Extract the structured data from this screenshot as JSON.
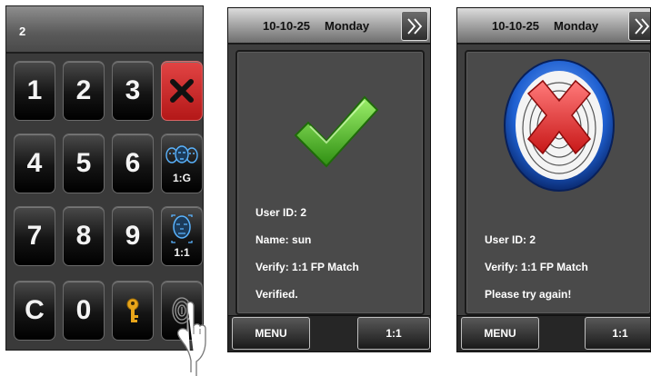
{
  "keypad": {
    "display_value": "2",
    "keys": {
      "k1": "1",
      "k2": "2",
      "k3": "3",
      "k4": "4",
      "k5": "5",
      "k6": "6",
      "k7": "7",
      "k8": "8",
      "k9": "9",
      "clear": "C",
      "k0": "0"
    },
    "group_verify_label": "1:G",
    "single_verify_label": "1:1",
    "icons": [
      "delete-x-icon",
      "group-faces-icon",
      "face-icon",
      "key-icon",
      "fingerprint-icon",
      "pointing-hand-icon"
    ]
  },
  "success_screen": {
    "date": "10-10-25",
    "day": "Monday",
    "lines": {
      "user_id": "User ID: 2",
      "name": "Name: sun",
      "verify": "Verify: 1:1 FP Match",
      "result": "Verified."
    },
    "menu_label": "MENU",
    "mode_label": "1:1",
    "icons": [
      "double-chevron-right-icon",
      "green-check-icon"
    ]
  },
  "failure_screen": {
    "date": "10-10-25",
    "day": "Monday",
    "lines": {
      "user_id": "User ID: 2",
      "verify": "Verify: 1:1 FP Match",
      "result": "Please try again!"
    },
    "menu_label": "MENU",
    "mode_label": "1:1",
    "icons": [
      "double-chevron-right-icon",
      "fingerprint-fail-icon"
    ]
  },
  "colors": {
    "delete_key": "#c62222",
    "check_green": "#3fae1c",
    "fail_red": "#e23a3a",
    "fail_ring_blue": "#1e5fd0"
  }
}
